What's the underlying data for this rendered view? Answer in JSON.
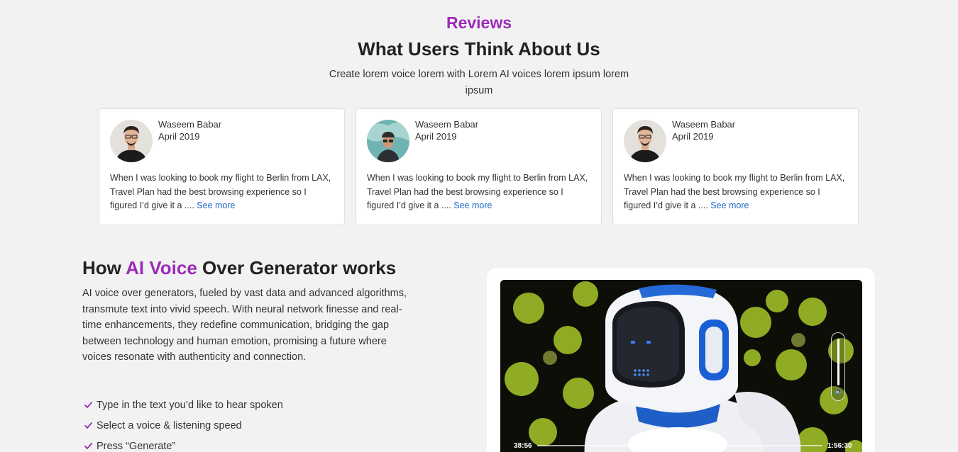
{
  "reviews": {
    "eyebrow": "Reviews",
    "title": "What Users Think About Us",
    "subtitle": "Create lorem voice lorem with Lorem AI voices lorem ipsum lorem ipsum",
    "cards": [
      {
        "name": "Waseem Babar",
        "date": "April 2019",
        "text": "When I was looking to book my flight to Berlin from LAX, Travel Plan had the best browsing experience so I figured I’d give it a ....",
        "more": "See more"
      },
      {
        "name": "Waseem Babar",
        "date": "April 2019",
        "text": "When I was looking to book my flight to Berlin from LAX, Travel Plan had the best browsing experience so I figured I’d give it a ....",
        "more": "See more"
      },
      {
        "name": "Waseem Babar",
        "date": "April 2019",
        "text": "When I was looking to book my flight to Berlin from LAX, Travel Plan had the best browsing experience so I figured I’d give it a ....",
        "more": "See more"
      }
    ]
  },
  "how": {
    "title_prefix": "How ",
    "title_accent": "AI Voice",
    "title_suffix": " Over Generator works",
    "body": "AI voice over generators, fueled by vast data and advanced algorithms, transmute text into vivid speech. With neural network finesse and real-time enhancements, they redefine communication, bridging the gap between technology and human emotion, promising a future where voices resonate with authenticity and connection.",
    "steps": [
      "Type in the text you’d like to hear spoken",
      "Select a voice & listening speed",
      "Press “Generate”"
    ]
  },
  "video": {
    "current_time": "38:56",
    "duration": "1:56:30",
    "progress": 0.38,
    "volume_icon": "speaker-icon"
  },
  "colors": {
    "accent": "#9b2bb8",
    "link": "#1a67c9",
    "background": "#f2f2f2"
  }
}
